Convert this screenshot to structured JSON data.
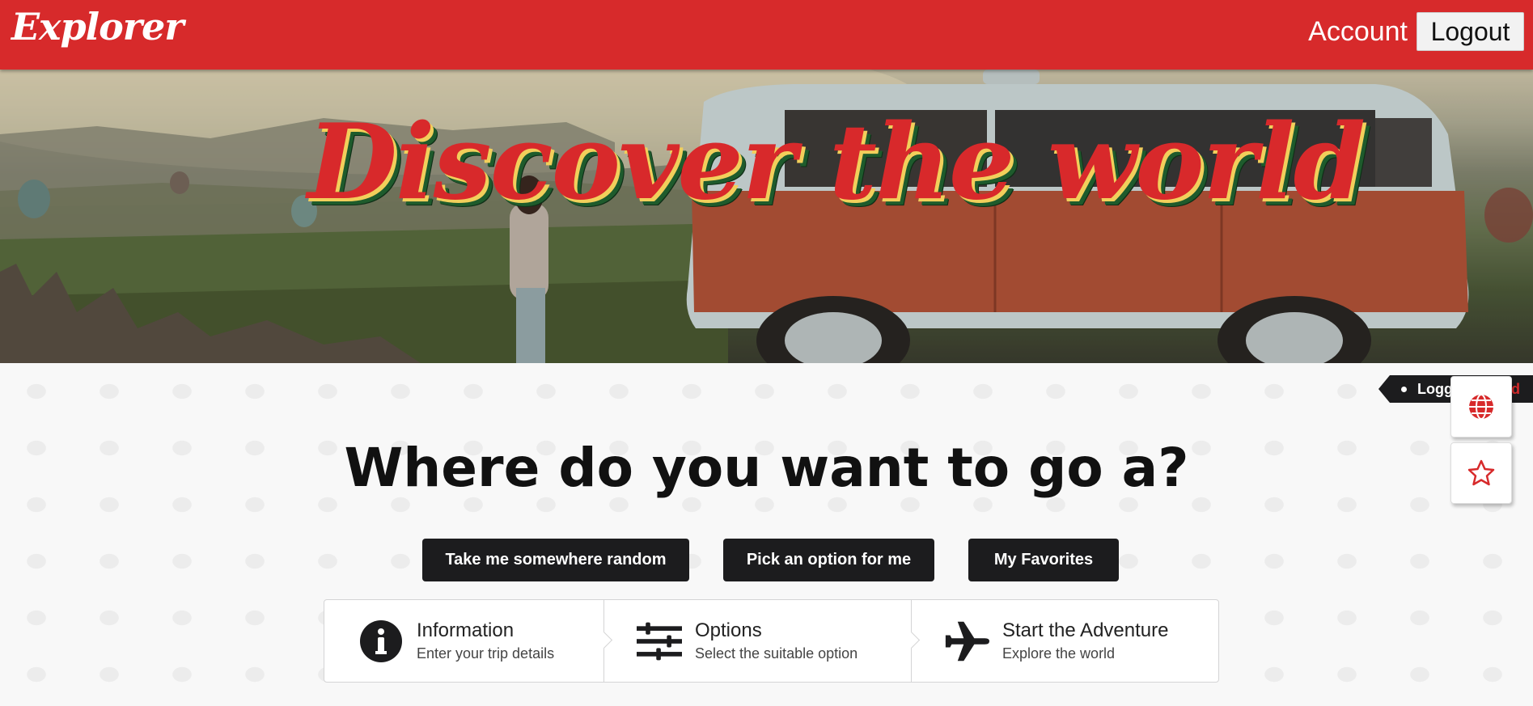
{
  "header": {
    "logo": "Explorer",
    "account_label": "Account",
    "logout_label": "Logout"
  },
  "hero": {
    "title": "Discover the world"
  },
  "main": {
    "heading": "Where do you want to go a?",
    "buttons": {
      "random": "Take me somewhere random",
      "pick": "Pick an option for me",
      "favorites": "My Favorites"
    },
    "steps": [
      {
        "icon": "info-circle-icon",
        "title": "Information",
        "description": "Enter your trip details"
      },
      {
        "icon": "sliders-icon",
        "title": "Options",
        "description": "Select the suitable option"
      },
      {
        "icon": "airplane-icon",
        "title": "Start the Adventure",
        "description": "Explore the world"
      }
    ]
  },
  "sidebar": {
    "status_text_visible": "Logg",
    "status_text_hidden_end": "d",
    "globe_button_icon": "globe-icon",
    "favorite_button_icon": "star-icon"
  },
  "colors": {
    "brand_red": "#d72a2b",
    "dark": "#1c1c1e",
    "title_shadow_yellow": "#f2cf5b",
    "title_shadow_green": "#1e5b2c"
  }
}
